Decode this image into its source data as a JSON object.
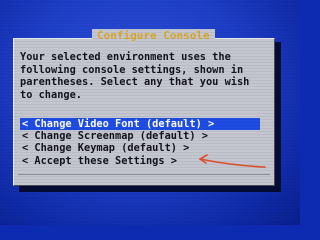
{
  "dialog": {
    "title": "Configure Console",
    "message_lines": [
      "Your selected environment uses the",
      "following console settings, shown in",
      "parentheses. Select any that you wish",
      "to change."
    ]
  },
  "menu": {
    "items": [
      {
        "label": "< Change Video Font (default) >",
        "selected": true
      },
      {
        "label": "< Change Screenmap (default) >",
        "selected": false
      },
      {
        "label": "< Change Keymap (default) >",
        "selected": false
      },
      {
        "label": "< Accept these Settings >",
        "selected": false
      }
    ]
  },
  "colors": {
    "screen_blue": "#1e3fc8",
    "dialog_gray": "#c3c6cf",
    "title_gold": "#d9a82a",
    "highlight_blue": "#1f4de3",
    "annotation_arrow": "#e0502a"
  }
}
